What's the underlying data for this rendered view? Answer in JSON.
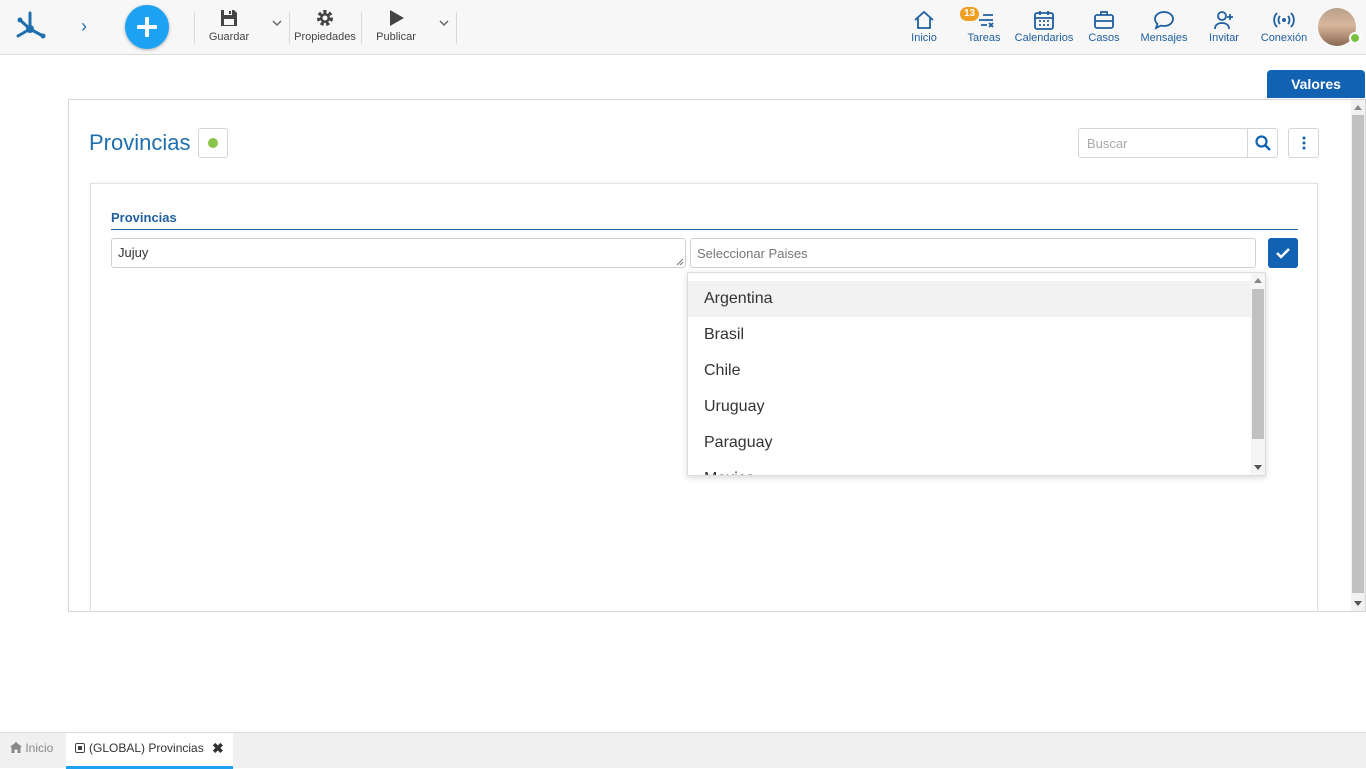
{
  "toolbar": {
    "save_label": "Guardar",
    "properties_label": "Propiedades",
    "publish_label": "Publicar"
  },
  "nav": {
    "home_label": "Inicio",
    "tasks_label": "Tareas",
    "tasks_badge": "13",
    "calendars_label": "Calendarios",
    "cases_label": "Casos",
    "messages_label": "Mensajes",
    "invite_label": "Invitar",
    "connection_label": "Conexión"
  },
  "valores_label": "Valores",
  "page": {
    "title": "Provincias",
    "search_placeholder": "Buscar",
    "section_title": "Provincias",
    "name_value": "Jujuy",
    "country_placeholder": "Seleccionar Paises"
  },
  "dropdown": {
    "options": [
      "Argentina",
      "Brasil",
      "Chile",
      "Uruguay",
      "Paraguay",
      "Mexico"
    ]
  },
  "tabs": {
    "home_label": "Inicio",
    "active_label": "(GLOBAL) Provincias"
  },
  "colors": {
    "primary": "#1262b3",
    "accent": "#1da1f2",
    "status_ok": "#8bc34a",
    "badge": "#f0a020"
  }
}
